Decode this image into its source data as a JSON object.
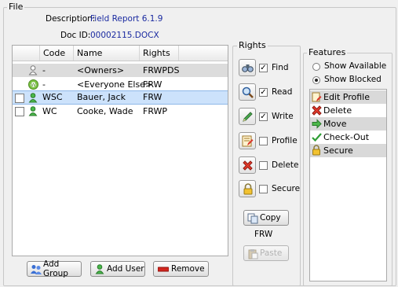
{
  "file_group": {
    "title": "File",
    "description_label": "Description:",
    "description_value": "Field Report 6.1.9",
    "docid_label": "Doc ID:",
    "docid_value": "00002115.DOCX"
  },
  "table": {
    "columns": [
      "Code",
      "Name",
      "Rights"
    ],
    "sort_indicator": "▲",
    "rows": [
      {
        "code": "-",
        "name": "<Owners>",
        "rights": "FRWPDS",
        "icon": "owner-person-icon",
        "checkbox": false,
        "selected": false,
        "shaded": true
      },
      {
        "code": "-",
        "name": "<Everyone Else>",
        "rights": "FRW",
        "icon": "everyone-icon",
        "checkbox": false,
        "selected": false,
        "shaded": false
      },
      {
        "code": "WSC",
        "name": "Bauer, Jack",
        "rights": "FRW",
        "icon": "user-icon",
        "checkbox": true,
        "selected": true,
        "shaded": false
      },
      {
        "code": "WC",
        "name": "Cooke, Wade",
        "rights": "FRWP",
        "icon": "user-icon",
        "checkbox": true,
        "selected": false,
        "shaded": false
      }
    ]
  },
  "buttons": {
    "add_group": "Add Group",
    "add_user": "Add User",
    "remove": "Remove",
    "copy": "Copy",
    "paste": "Paste"
  },
  "rights_group": {
    "title": "Rights",
    "items": [
      {
        "label": "Find",
        "checked": true,
        "icon": "binoculars-icon"
      },
      {
        "label": "Read",
        "checked": true,
        "icon": "magnifier-icon"
      },
      {
        "label": "Write",
        "checked": true,
        "icon": "pencil-icon"
      },
      {
        "label": "Profile",
        "checked": false,
        "icon": "profile-edit-icon"
      },
      {
        "label": "Delete",
        "checked": false,
        "icon": "delete-x-icon"
      },
      {
        "label": "Secure",
        "checked": false,
        "icon": "lock-icon"
      }
    ],
    "current_rights": "FRW"
  },
  "features_group": {
    "title": "Features",
    "show_available": "Show Available",
    "show_blocked": "Show Blocked",
    "selected_option": "Show Blocked",
    "items": [
      {
        "label": "Edit Profile",
        "icon": "profile-edit-icon",
        "shaded": true
      },
      {
        "label": "Delete",
        "icon": "delete-x-icon",
        "shaded": false
      },
      {
        "label": "Move",
        "icon": "arrow-right-icon",
        "shaded": true
      },
      {
        "label": "Check-Out",
        "icon": "checkmark-icon",
        "shaded": false
      },
      {
        "label": "Secure",
        "icon": "lock-icon",
        "shaded": true
      }
    ]
  }
}
